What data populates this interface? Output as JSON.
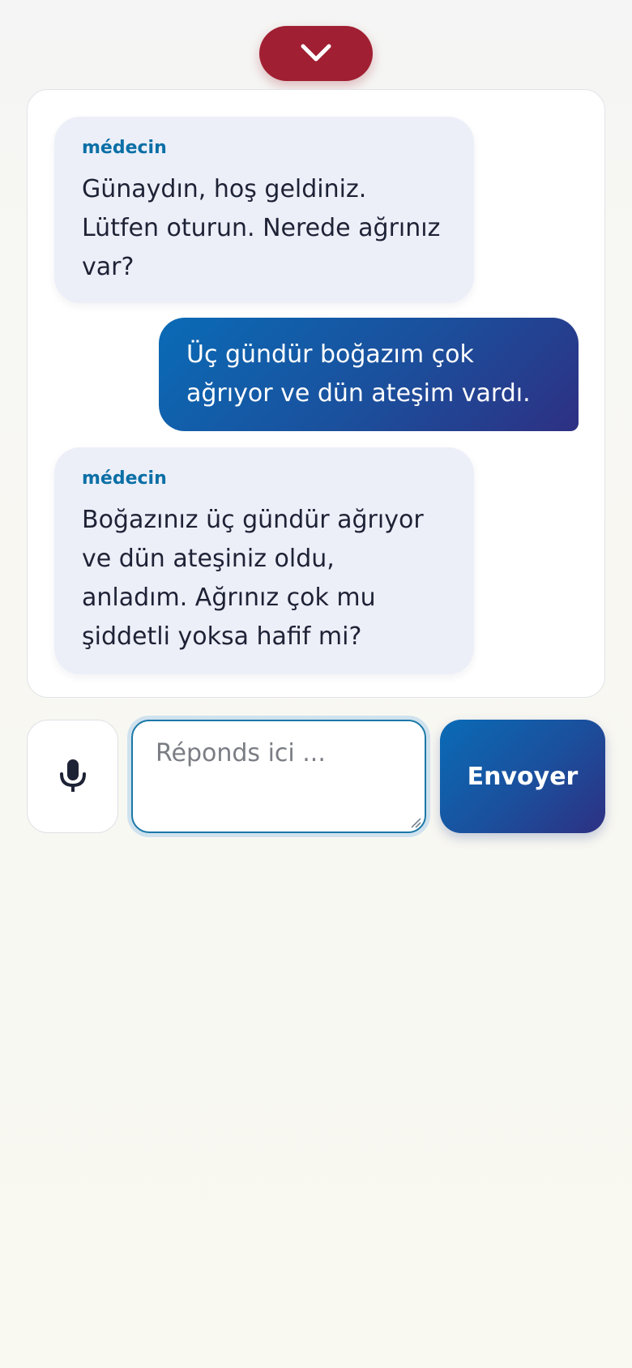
{
  "header": {
    "collapse_icon": "chevron-down-icon",
    "collapse_color": "#a11f32"
  },
  "chat": {
    "messages": [
      {
        "role": "bot",
        "sender": "médecin",
        "text": "Günaydın, hoş geldiniz. Lütfen oturun. Nerede ağrınız var?"
      },
      {
        "role": "user",
        "text": "Üç gündür boğazım çok ağrıyor ve dün ateşim vardı."
      },
      {
        "role": "bot",
        "sender": "médecin",
        "text": "Boğazınız üç gündür ağrıyor ve dün ateşiniz oldu, anladım. Ağrınız çok mu şiddetli yoksa hafif mi?"
      }
    ]
  },
  "composer": {
    "mic_icon": "microphone-icon",
    "input_placeholder": "Réponds ici ...",
    "input_value": "",
    "send_label": "Envoyer"
  },
  "colors": {
    "accent": "#0b6fa6",
    "user_bubble_start": "#0a6bb6",
    "user_bubble_end": "#2e3083",
    "bot_bubble": "#eceff8"
  }
}
